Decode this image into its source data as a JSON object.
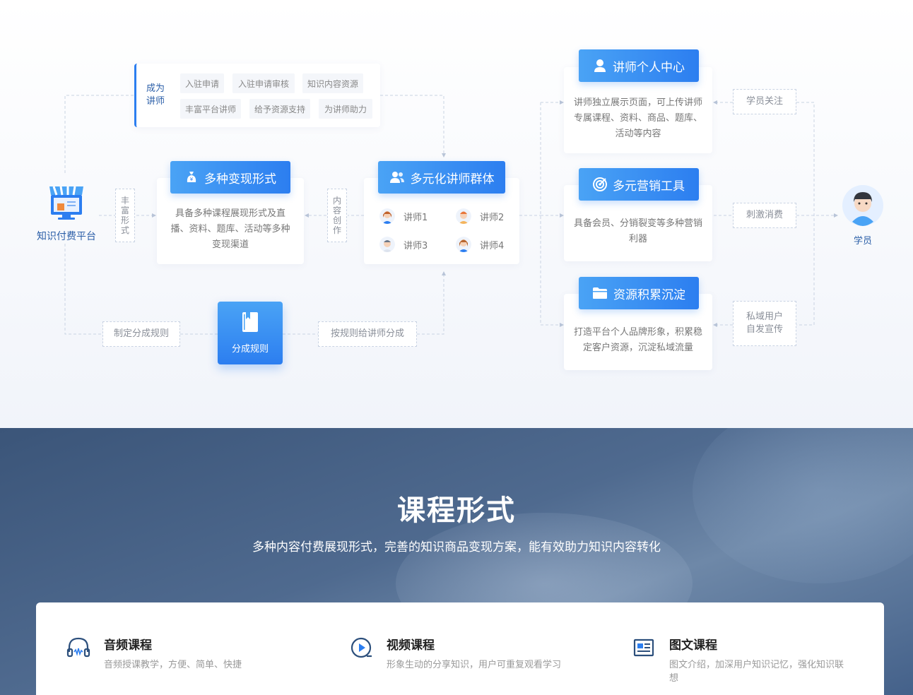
{
  "platform": {
    "label": "知识付费平台"
  },
  "become_lecturer": {
    "label": "成为讲师",
    "tags": [
      "入驻申请",
      "入驻申请审核",
      "知识内容资源",
      "丰富平台讲师",
      "给予资源支持",
      "为讲师助力"
    ]
  },
  "monetize": {
    "title": "多种变现形式",
    "desc": "具备多种课程展现形式及直播、资料、题库、活动等多种变现渠道"
  },
  "rich_forms_tag": "丰富形式",
  "content_creation_tag": "内容创作",
  "lecturer_group": {
    "title": "多元化讲师群体",
    "lecturers": [
      "讲师1",
      "讲师2",
      "讲师3",
      "讲师4"
    ]
  },
  "split_rules": {
    "label": "分成规则",
    "left_tag": "制定分成规则",
    "right_tag": "按规则给讲师分成"
  },
  "center": {
    "title": "讲师个人中心",
    "desc": "讲师独立展示页面，可上传讲师专属课程、资料、商品、题库、活动等内容"
  },
  "marketing": {
    "title": "多元营销工具",
    "desc": "具备会员、分销裂变等多种营销利器"
  },
  "resources": {
    "title": "资源积累沉淀",
    "desc": "打造平台个人品牌形象，积累稳定客户资源，沉淀私域流量"
  },
  "student_tags": [
    "学员关注",
    "刺激消费",
    "私域用户自发宣传"
  ],
  "student": {
    "label": "学员"
  },
  "course_section": {
    "title": "课程形式",
    "subtitle": "多种内容付费展现形式，完善的知识商品变现方案，能有效助力知识内容转化",
    "features": [
      {
        "icon": "headphones-icon",
        "title": "音频课程",
        "desc": "音频授课教学，方便、简单、快捷"
      },
      {
        "icon": "video-play-icon",
        "title": "视频课程",
        "desc": "形象生动的分享知识，用户可重复观看学习"
      },
      {
        "icon": "article-icon",
        "title": "图文课程",
        "desc": "图文介绍，加深用户知识记忆，强化知识联想"
      }
    ]
  },
  "colors": {
    "accent": "#2c7ef0",
    "accent_light": "#4aa3f5",
    "dark_bg": "#3b5579"
  }
}
